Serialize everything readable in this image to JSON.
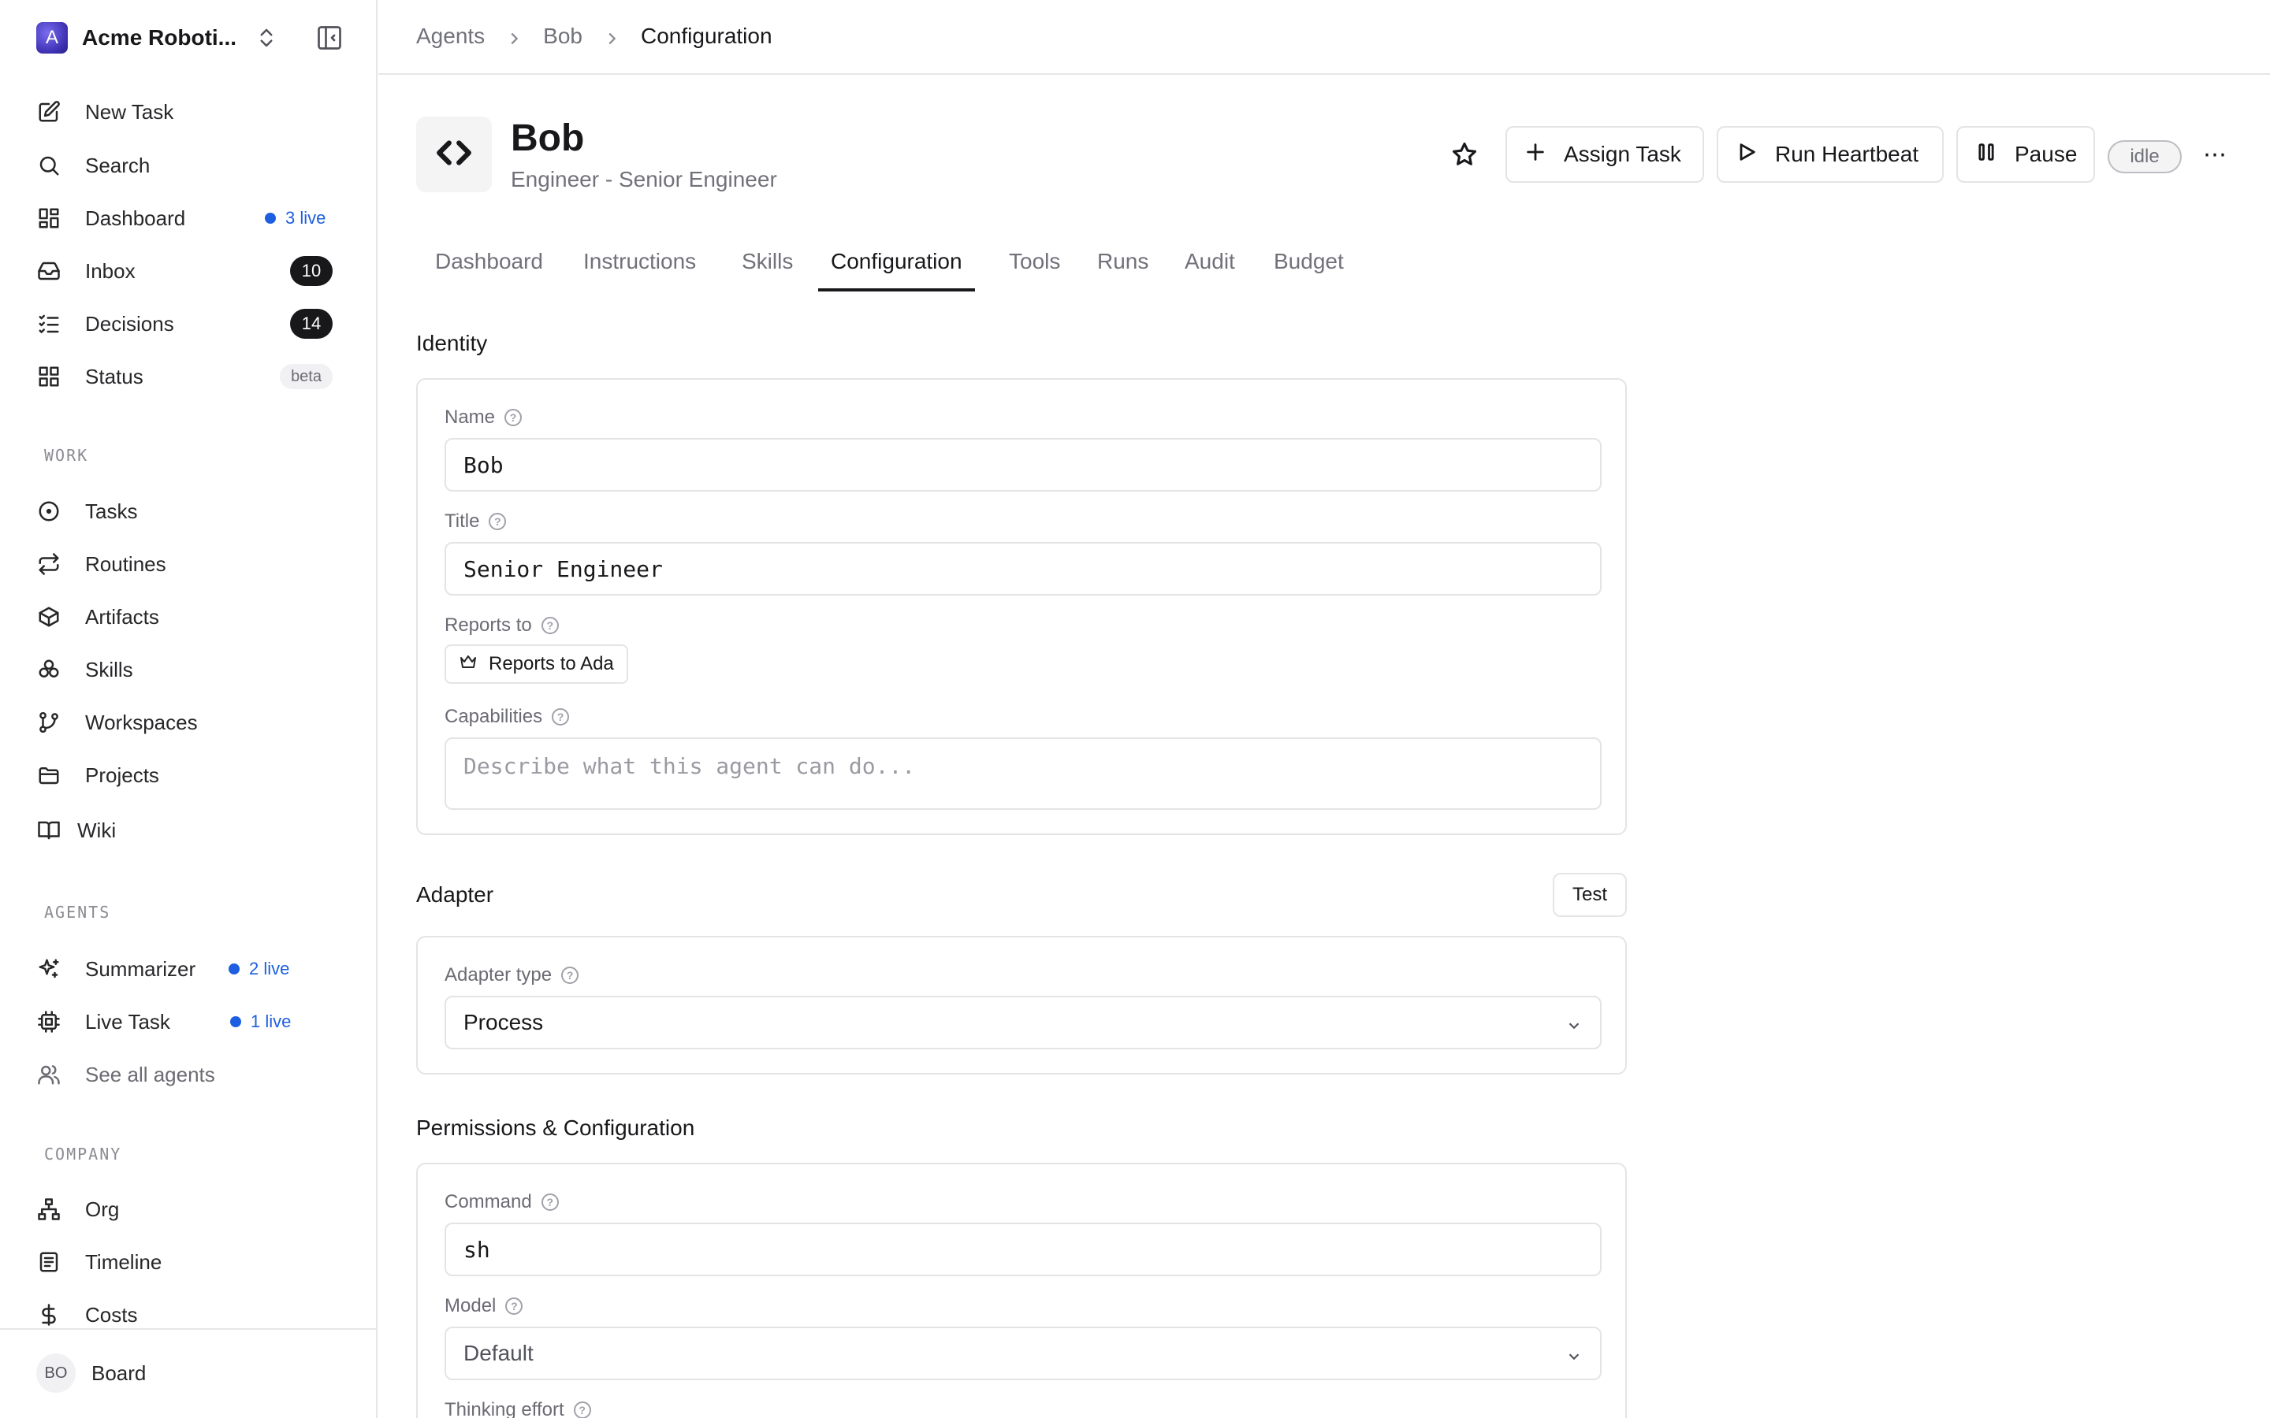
{
  "org": {
    "initial": "A",
    "name": "Acme Roboti..."
  },
  "nav_primary": [
    {
      "label": "New Task",
      "icon": "pencil-square-icon"
    },
    {
      "label": "Search",
      "icon": "search-icon"
    },
    {
      "label": "Dashboard",
      "icon": "dashboard-icon",
      "live": "3 live"
    },
    {
      "label": "Inbox",
      "icon": "inbox-icon",
      "count": "10"
    },
    {
      "label": "Decisions",
      "icon": "checklist-icon",
      "count": "14"
    },
    {
      "label": "Status",
      "icon": "grid-icon",
      "badge": "beta"
    }
  ],
  "work": {
    "heading": "WORK",
    "items": [
      {
        "label": "Tasks",
        "icon": "circle-dot-icon"
      },
      {
        "label": "Routines",
        "icon": "repeat-icon"
      },
      {
        "label": "Artifacts",
        "icon": "box-icon"
      },
      {
        "label": "Skills",
        "icon": "skills-icon"
      },
      {
        "label": "Workspaces",
        "icon": "branch-icon"
      },
      {
        "label": "Projects",
        "icon": "folder-icon"
      },
      {
        "label": "Wiki",
        "icon": "book-icon"
      }
    ]
  },
  "agents": {
    "heading": "AGENTS",
    "items": [
      {
        "label": "Summarizer",
        "icon": "sparkles-icon",
        "live": "2 live"
      },
      {
        "label": "Live Task",
        "icon": "cpu-icon",
        "live": "1 live"
      },
      {
        "label": "See all agents",
        "icon": "users-icon"
      }
    ]
  },
  "company": {
    "heading": "COMPANY",
    "items": [
      {
        "label": "Org",
        "icon": "org-chart-icon"
      },
      {
        "label": "Timeline",
        "icon": "timeline-icon"
      },
      {
        "label": "Costs",
        "icon": "dollar-icon"
      }
    ]
  },
  "user": {
    "initials": "BO",
    "name": "Board"
  },
  "breadcrumb": [
    "Agents",
    "Bob",
    "Configuration"
  ],
  "agent": {
    "name": "Bob",
    "subtitle": "Engineer - Senior Engineer",
    "status": "idle"
  },
  "actions": {
    "assign": "Assign Task",
    "heartbeat": "Run Heartbeat",
    "pause": "Pause",
    "more": "⋯"
  },
  "tabs": [
    "Dashboard",
    "Instructions",
    "Skills",
    "Configuration",
    "Tools",
    "Runs",
    "Audit",
    "Budget"
  ],
  "active_tab": "Configuration",
  "identity": {
    "title": "Identity",
    "name_label": "Name",
    "name_value": "Bob",
    "title_label": "Title",
    "title_value": "Senior Engineer",
    "reports_label": "Reports to",
    "reports_value": "Reports to Ada",
    "capabilities_label": "Capabilities",
    "capabilities_placeholder": "Describe what this agent can do..."
  },
  "adapter": {
    "title": "Adapter",
    "test_label": "Test",
    "type_label": "Adapter type",
    "type_value": "Process"
  },
  "permissions": {
    "title": "Permissions & Configuration",
    "command_label": "Command",
    "command_value": "sh",
    "model_label": "Model",
    "model_value": "Default",
    "thinking_label": "Thinking effort"
  }
}
